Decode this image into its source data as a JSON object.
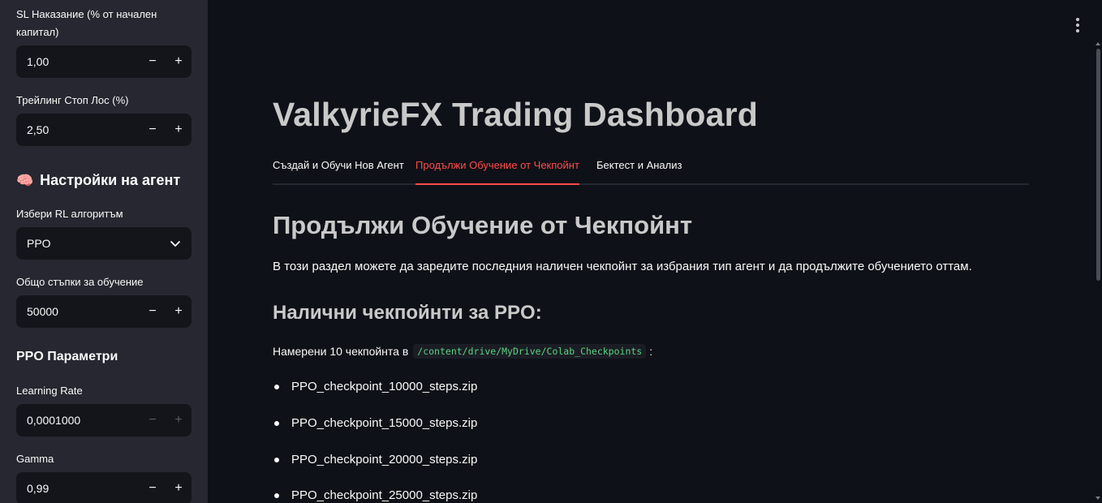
{
  "sidebar": {
    "sl_penalty": {
      "label": "SL Наказание (% от начален капитал)",
      "value": "1,00"
    },
    "trailing_stop": {
      "label": "Трейлинг Стоп Лос (%)",
      "value": "2,50"
    },
    "agent_settings_heading": {
      "icon": "🧠",
      "text": "Настройки на агент"
    },
    "algorithm": {
      "label": "Избери RL алгоритъм",
      "value": "PPO"
    },
    "total_steps": {
      "label": "Общо стъпки за обучение",
      "value": "50000"
    },
    "ppo_params_heading": "PPO Параметри",
    "learning_rate": {
      "label": "Learning Rate",
      "value": "0,0001000"
    },
    "gamma": {
      "label": "Gamma",
      "value": "0,99"
    },
    "minus": "−",
    "plus": "+"
  },
  "main": {
    "title": "ValkyrieFX Trading Dashboard",
    "tabs": [
      {
        "label": "Създай и Обучи Нов Агент"
      },
      {
        "label": "Продължи Обучение от Чекпойнт"
      },
      {
        "label": "Бектест и Анализ"
      }
    ],
    "active_tab": 1,
    "section_title": "Продължи Обучение от Чекпойнт",
    "description": "В този раздел можете да заредите последния наличен чекпойнт за избрания тип агент и да продължите обучението оттам.",
    "checkpoints_heading": "Налични чекпойнти за PPO:",
    "found_prefix": "Намерени 10 чекпойнта в",
    "found_path": "/content/drive/MyDrive/Colab_Checkpoints",
    "found_suffix": ":",
    "checkpoints": [
      "PPO_checkpoint_10000_steps.zip",
      "PPO_checkpoint_15000_steps.zip",
      "PPO_checkpoint_20000_steps.zip",
      "PPO_checkpoint_25000_steps.zip"
    ]
  },
  "colors": {
    "accent": "#ff4b4b",
    "sidebar_bg": "#262730",
    "main_bg": "#0e1117",
    "code_text": "#5ad282"
  }
}
